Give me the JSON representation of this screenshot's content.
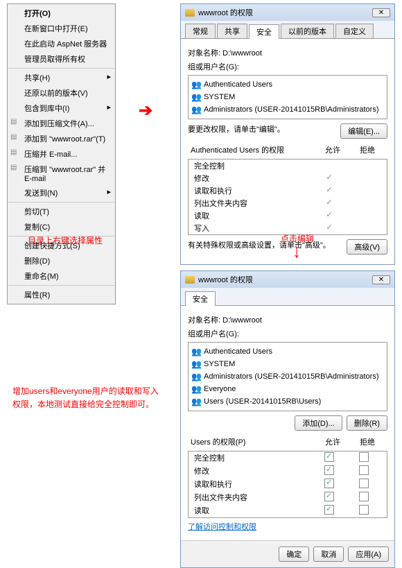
{
  "menu": {
    "open": "打开(O)",
    "open_new_window": "在新窗口中打开(E)",
    "start_aspnet": "在此启动 AspNet 服务器",
    "grant_admin": "管理员取得所有权",
    "shared": "共享(H)",
    "restore_versions": "还原以前的版本(V)",
    "include_library": "包含到库中(I)",
    "add_compressed": "添加到压缩文件(A)...",
    "add_to_rar": "添加到 \"wwwroot.rar\"(T)",
    "compress_email": "压缩并 E-mail...",
    "compress_rar_email": "压缩到 \"wwwroot.rar\" 并 E-mail",
    "send_to": "发送到(N)",
    "cut": "剪切(T)",
    "copy": "复制(C)",
    "create_shortcut": "创建快捷方式(S)",
    "delete": "删除(D)",
    "rename": "重命名(M)",
    "properties": "属性(R)"
  },
  "notes": {
    "n1": "目录上右键选择属性",
    "n2": "点击编辑",
    "n3": "增加users和everyone用户的读取和写入权限，本地测试直接给完全控制即可。"
  },
  "arrows": {
    "right": "➔",
    "down": "↓"
  },
  "dlg1": {
    "title": "wwwroot 的权限",
    "tabs": {
      "general": "常规",
      "sharing": "共享",
      "security": "安全",
      "previous": "以前的版本",
      "custom": "自定义"
    },
    "object_label": "对象名称:",
    "object_path": "D:\\wwwroot",
    "groups_label": "组或用户名(G):",
    "groups": [
      "Authenticated Users",
      "SYSTEM",
      "Administrators (USER-20141015RB\\Administrators)"
    ],
    "change_text": "要更改权限，请单击\"编辑\"。",
    "edit_btn": "编辑(E)...",
    "perm_header": "Authenticated Users 的权限",
    "allow": "允许",
    "deny": "拒绝",
    "perms": [
      "完全控制",
      "修改",
      "读取和执行",
      "列出文件夹内容",
      "读取",
      "写入"
    ],
    "special_text": "有关特殊权限或高级设置，请单击\"高级\"。",
    "advanced_btn": "高级(V)"
  },
  "dlg2": {
    "title": "wwwroot 的权限",
    "tab": "安全",
    "object_label": "对象名称:",
    "object_path": "D:\\wwwroot",
    "groups_label": "组或用户名(G):",
    "groups": [
      "Authenticated Users",
      "SYSTEM",
      "Administrators (USER-20141015RB\\Administrators)",
      "Everyone",
      "Users (USER-20141015RB\\Users)"
    ],
    "add_btn": "添加(D)...",
    "remove_btn": "删除(R)",
    "perm_header": "Users 的权限(P)",
    "allow": "允许",
    "deny": "拒绝",
    "perms": [
      "完全控制",
      "修改",
      "读取和执行",
      "列出文件夹内容",
      "读取"
    ],
    "link": "了解访问控制和权限",
    "ok": "确定",
    "cancel": "取消",
    "apply": "应用(A)"
  }
}
